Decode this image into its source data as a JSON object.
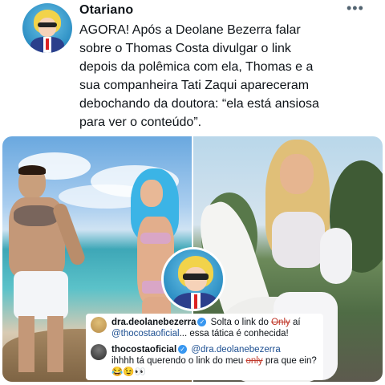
{
  "tweet": {
    "username": "Otariano",
    "more_label": "•••",
    "text": "AGORA! Após a Deolane Bezerra falar\nsobre o Thomas Costa divulgar o link\ndepois da polêmica com ela, Thomas e a\nsua companheira Tati Zaqui apareceram\ndebochando da doutora: “ela está ansiosa\npara ver o conteúdo”."
  },
  "comments": [
    {
      "user": "dra.deolanebezerra",
      "text_before": "Solta o link do ",
      "strike_word": "Only",
      "text_after": " aí",
      "line2_mention": "@thocostaoficial",
      "line2_text": "... essa tática é conhecida!"
    },
    {
      "user": "thocostaoficial",
      "mention": "@dra.deolanebezerra",
      "text_before": "ihhhh tá querendo o link do meu ",
      "strike_word": "only",
      "text_after": " pra que ein? 😂😉👀"
    }
  ],
  "icons": {
    "verified": "verified-badge-icon",
    "more": "more-options-icon"
  },
  "colors": {
    "text": "#0f1419",
    "verified": "#3897f0",
    "strike": "#c0392b",
    "mention": "#1d4f91"
  }
}
